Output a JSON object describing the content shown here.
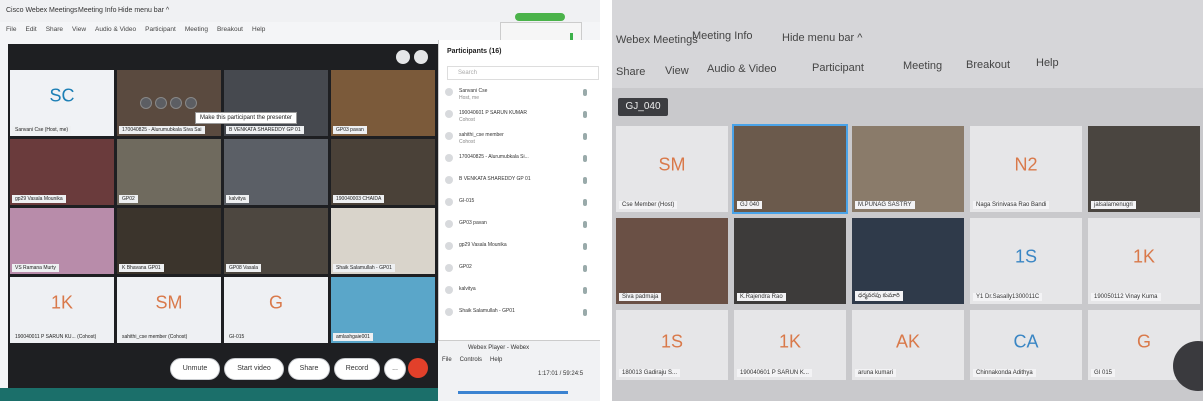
{
  "left": {
    "title": "Cisco Webex Meetings",
    "meeting_info": "Meeting Info",
    "hide_menu": "Hide menu bar ^",
    "menu": [
      "File",
      "Edit",
      "Share",
      "View",
      "Audio & Video",
      "Participant",
      "Meeting",
      "Breakout",
      "Help"
    ],
    "tooltip": "Make this participant the presenter",
    "tiles": [
      {
        "label": "Sanvani Cse (Host, me)",
        "initials": "SC",
        "color": "#1c7fb5",
        "bg": "#f0f2f5"
      },
      {
        "label": "170040825 - Alurumubkala Siva Sai",
        "initials": "",
        "bg": "#5a4a3f"
      },
      {
        "label": "B VENKATA SHAREDDY GP 01",
        "initials": "",
        "bg": "#46494f"
      },
      {
        "label": "GP03 pavan",
        "initials": "",
        "bg": "#7b5a3a"
      },
      {
        "label": "gp29 Vasala Mounika",
        "initials": "",
        "bg": "#6a3b3c"
      },
      {
        "label": "GP02",
        "initials": "",
        "bg": "#6f6a5e"
      },
      {
        "label": "kalvitya",
        "initials": "",
        "bg": "#5b5f66"
      },
      {
        "label": "190040003 CHAIDA",
        "initials": "",
        "bg": "#4a4138"
      },
      {
        "label": "VS Ramana Murty",
        "initials": "",
        "bg": "#b88caa"
      },
      {
        "label": "K Bhavana GP01",
        "initials": "",
        "bg": "#3b342c"
      },
      {
        "label": "GP08 Vasala",
        "initials": "",
        "bg": "#4d4740"
      },
      {
        "label": "Shaik Salamullah - GP01",
        "initials": "",
        "bg": "#d9d4cb"
      },
      {
        "label": "190040011 P SARUN KU... (Cohost)",
        "initials": "1K",
        "color": "#d9794a",
        "bg": "#eef0f3"
      },
      {
        "label": "sahithi_cse member (Cohost)",
        "initials": "SM",
        "color": "#d9794a",
        "bg": "#eef0f3"
      },
      {
        "label": "GI-015",
        "initials": "G",
        "color": "#d9794a",
        "bg": "#eef0f3"
      },
      {
        "label": "amlashgaie001",
        "initials": "",
        "bg": "#5aa6c9"
      }
    ],
    "controls": {
      "unmute": "Unmute",
      "start_video": "Start video",
      "share": "Share",
      "record": "Record",
      "more": "..."
    },
    "participants": {
      "header": "Participants (16)",
      "search_placeholder": "Search",
      "items": [
        {
          "name": "Sanvani Cse",
          "sub": "Host, me"
        },
        {
          "name": "190040601 P SARUN KUMAR",
          "sub": "Cohost"
        },
        {
          "name": "sahithi_cse member",
          "sub": "Cohost"
        },
        {
          "name": "170040825 - Alurumubkala Si...",
          "sub": ""
        },
        {
          "name": "B VENKATA SHAREDDY GP 01",
          "sub": ""
        },
        {
          "name": "GI-015",
          "sub": ""
        },
        {
          "name": "GP03 pavan",
          "sub": ""
        },
        {
          "name": "gp29 Vasala Mounika",
          "sub": ""
        },
        {
          "name": "GP02",
          "sub": ""
        },
        {
          "name": "kalvitya",
          "sub": ""
        },
        {
          "name": "Shaik Salamullah - GP01",
          "sub": ""
        }
      ]
    },
    "player": {
      "title": "Webex Player - Webex",
      "menu": [
        "File",
        "Controls",
        "Help"
      ],
      "time": "1:17:01 / 59:24:5"
    }
  },
  "right": {
    "menu_top": [
      "Webex Meetings",
      "Meeting Info",
      "Hide menu bar ^"
    ],
    "menu": [
      "Share",
      "View",
      "Audio & Video",
      "Participant",
      "Meeting",
      "Breakout",
      "Help"
    ],
    "badge": "GJ_040",
    "tiles": [
      {
        "label": "Cse Member (Host)",
        "initials": "SM",
        "color": "#d9794a"
      },
      {
        "label": "GJ 040",
        "initials": "",
        "bg": "#6b5a4c"
      },
      {
        "label": "M.PUNAG SASTRY",
        "initials": "",
        "bg": "#8a7b6a"
      },
      {
        "label": "Naga Srinivasa Rao Bandi",
        "initials": "N2",
        "color": "#d9794a"
      },
      {
        "label": "jalsalamenugri",
        "initials": "",
        "bg": "#4a4540"
      },
      {
        "label": "Siva padmaja",
        "initials": "",
        "bg": "#6a5045"
      },
      {
        "label": "K.Rajendra Rao",
        "initials": "",
        "bg": "#3d3b3a"
      },
      {
        "label": "ధర్మవరపు కుమారి",
        "initials": "",
        "bg": "#2f3a4a"
      },
      {
        "label": "Y1 Dr.Sasally1300011C",
        "initials": "1S",
        "color": "#3a86c4"
      },
      {
        "label": "190050112 Vinay Kuma",
        "initials": "1K",
        "color": "#d9794a"
      },
      {
        "label": "180013 Gadiraju S...",
        "initials": "1S",
        "color": "#d9794a"
      },
      {
        "label": "190040601 P SARUN K...",
        "initials": "1K",
        "color": "#d9794a"
      },
      {
        "label": "aruna kumari",
        "initials": "AK",
        "color": "#d9794a"
      },
      {
        "label": "Chinnakonda Adithya",
        "initials": "CA",
        "color": "#3a86c4"
      },
      {
        "label": "GI 015",
        "initials": "G",
        "color": "#d9794a"
      }
    ]
  }
}
